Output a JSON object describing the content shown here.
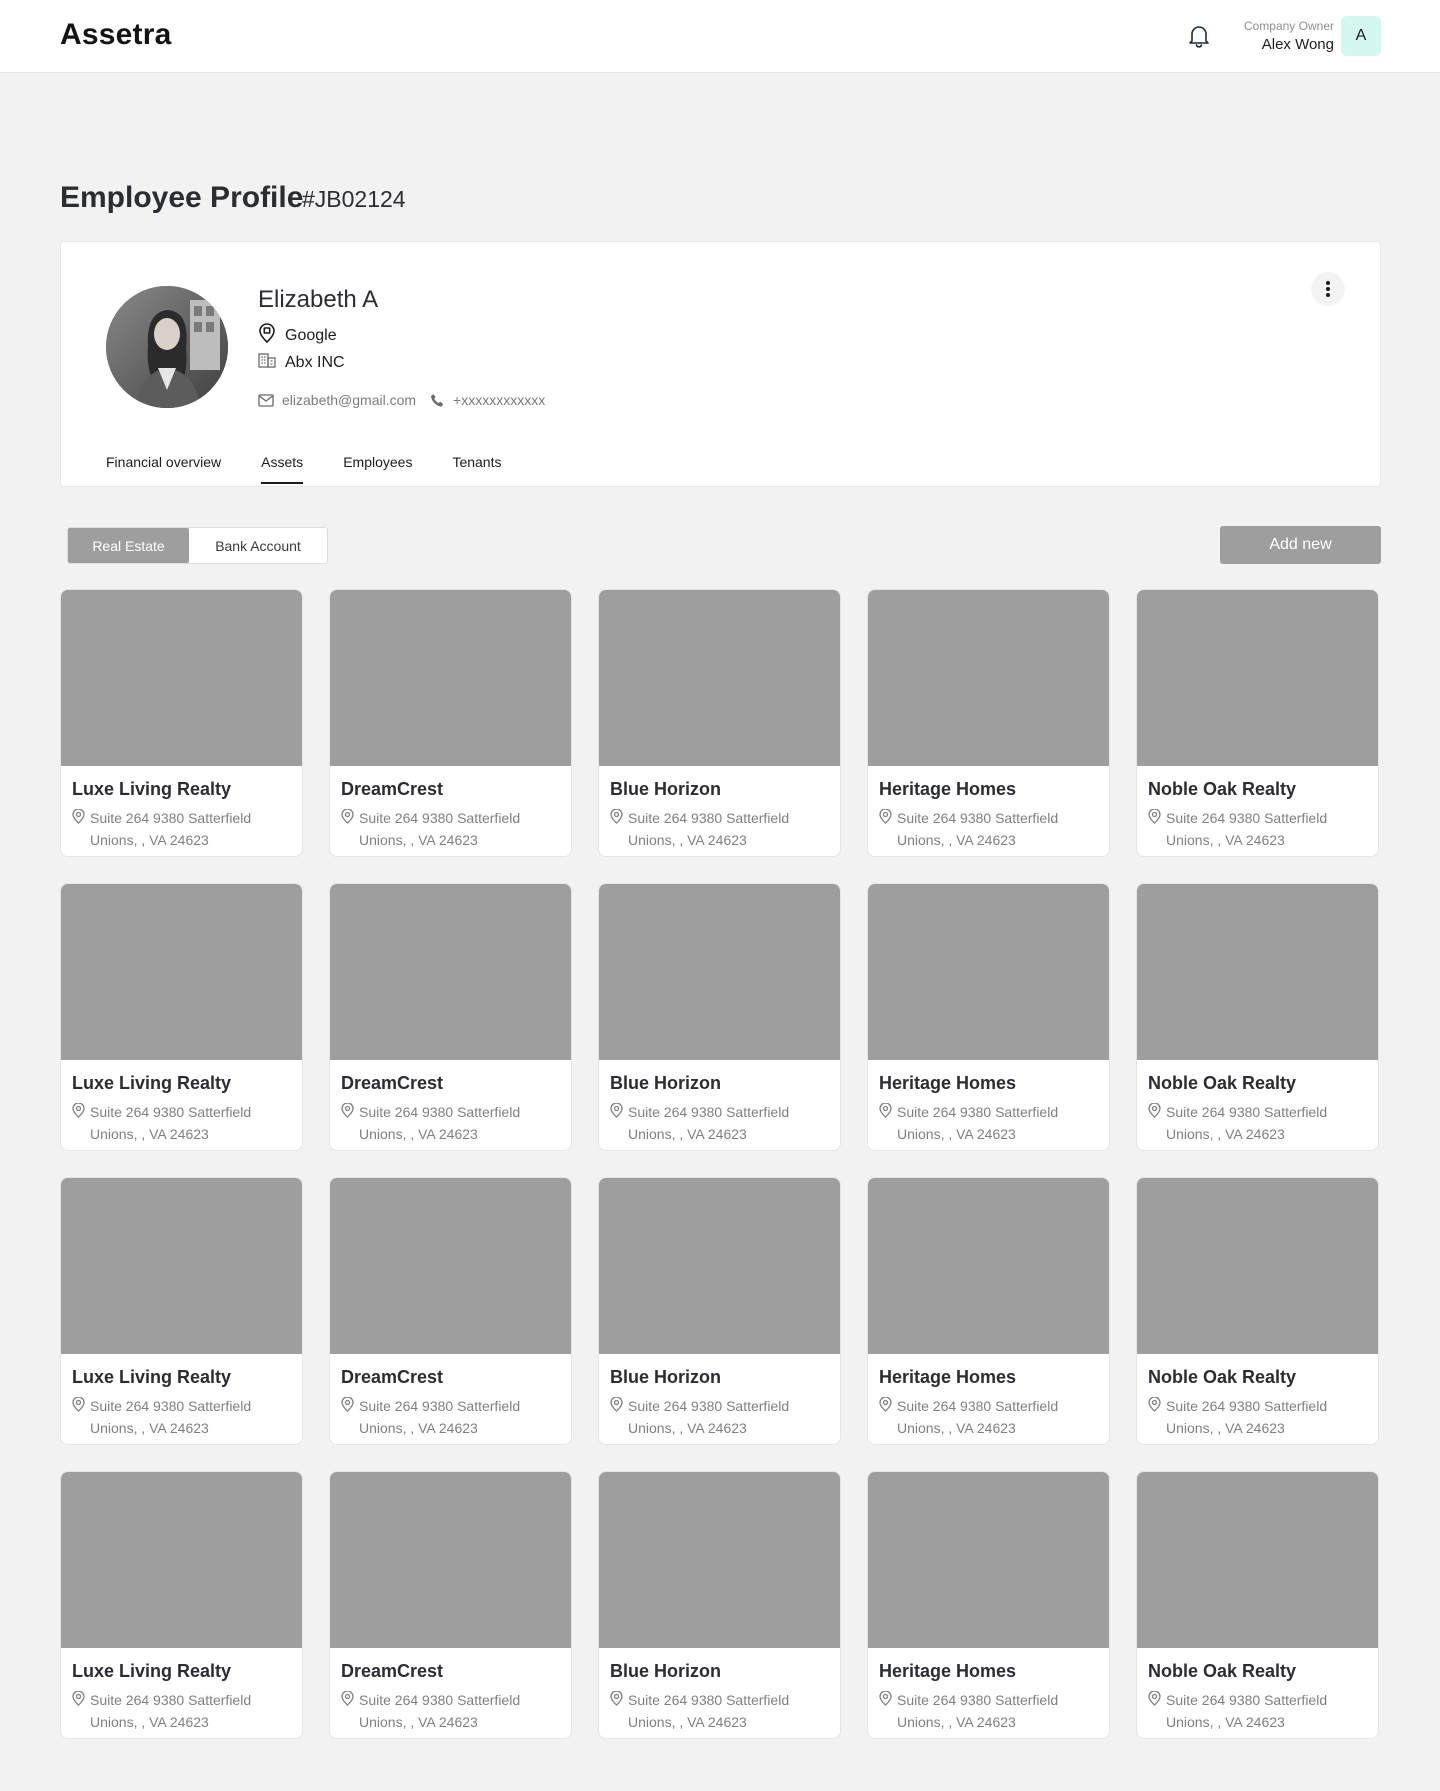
{
  "app": {
    "brand": "Assetra"
  },
  "header": {
    "user_role": "Company Owner",
    "user_name": "Alex Wong",
    "avatar_initial": "A",
    "icons": [
      "bell-icon"
    ]
  },
  "page": {
    "title": "Employee Profile",
    "id": "#JB02124"
  },
  "profile": {
    "name": "Elizabeth A",
    "location": "Google",
    "company": "Abx INC",
    "email": "elizabeth@gmail.com",
    "phone": "+xxxxxxxxxxxx"
  },
  "tabs": [
    {
      "label": "Financial overview",
      "active": false
    },
    {
      "label": "Assets",
      "active": true
    },
    {
      "label": "Employees",
      "active": false
    },
    {
      "label": "Tenants",
      "active": false
    }
  ],
  "segment": {
    "options": [
      "Real Estate",
      "Bank Account"
    ],
    "selected": "Real Estate"
  },
  "add_button": {
    "label": "Add new"
  },
  "colors": {
    "accent_gray": "#9e9e9e",
    "avatar_bg": "#d5f7f1",
    "page_bg": "#f1f2f1"
  },
  "assets": [
    {
      "name": "Luxe Living Realty",
      "addr1": "Suite 264 9380 Satterfield",
      "addr2": "Unions, , VA 24623"
    },
    {
      "name": "DreamCrest",
      "addr1": "Suite 264 9380 Satterfield",
      "addr2": "Unions, , VA 24623"
    },
    {
      "name": "Blue Horizon",
      "addr1": "Suite 264 9380 Satterfield",
      "addr2": "Unions, , VA 24623"
    },
    {
      "name": "Heritage Homes",
      "addr1": "Suite 264 9380 Satterfield",
      "addr2": "Unions, , VA 24623"
    },
    {
      "name": "Noble Oak Realty",
      "addr1": "Suite 264 9380 Satterfield",
      "addr2": "Unions, , VA 24623"
    },
    {
      "name": "Luxe Living Realty",
      "addr1": "Suite 264 9380 Satterfield",
      "addr2": "Unions, , VA 24623"
    },
    {
      "name": "DreamCrest",
      "addr1": "Suite 264 9380 Satterfield",
      "addr2": "Unions, , VA 24623"
    },
    {
      "name": "Blue Horizon",
      "addr1": "Suite 264 9380 Satterfield",
      "addr2": "Unions, , VA 24623"
    },
    {
      "name": "Heritage Homes",
      "addr1": "Suite 264 9380 Satterfield",
      "addr2": "Unions, , VA 24623"
    },
    {
      "name": "Noble Oak Realty",
      "addr1": "Suite 264 9380 Satterfield",
      "addr2": "Unions, , VA 24623"
    },
    {
      "name": "Luxe Living Realty",
      "addr1": "Suite 264 9380 Satterfield",
      "addr2": "Unions, , VA 24623"
    },
    {
      "name": "DreamCrest",
      "addr1": "Suite 264 9380 Satterfield",
      "addr2": "Unions, , VA 24623"
    },
    {
      "name": "Blue Horizon",
      "addr1": "Suite 264 9380 Satterfield",
      "addr2": "Unions, , VA 24623"
    },
    {
      "name": "Heritage Homes",
      "addr1": "Suite 264 9380 Satterfield",
      "addr2": "Unions, , VA 24623"
    },
    {
      "name": "Noble Oak Realty",
      "addr1": "Suite 264 9380 Satterfield",
      "addr2": "Unions, , VA 24623"
    },
    {
      "name": "Luxe Living Realty",
      "addr1": "Suite 264 9380 Satterfield",
      "addr2": "Unions, , VA 24623"
    },
    {
      "name": "DreamCrest",
      "addr1": "Suite 264 9380 Satterfield",
      "addr2": "Unions, , VA 24623"
    },
    {
      "name": "Blue Horizon",
      "addr1": "Suite 264 9380 Satterfield",
      "addr2": "Unions, , VA 24623"
    },
    {
      "name": "Heritage Homes",
      "addr1": "Suite 264 9380 Satterfield",
      "addr2": "Unions, , VA 24623"
    },
    {
      "name": "Noble Oak Realty",
      "addr1": "Suite 264 9380 Satterfield",
      "addr2": "Unions, , VA 24623"
    }
  ]
}
